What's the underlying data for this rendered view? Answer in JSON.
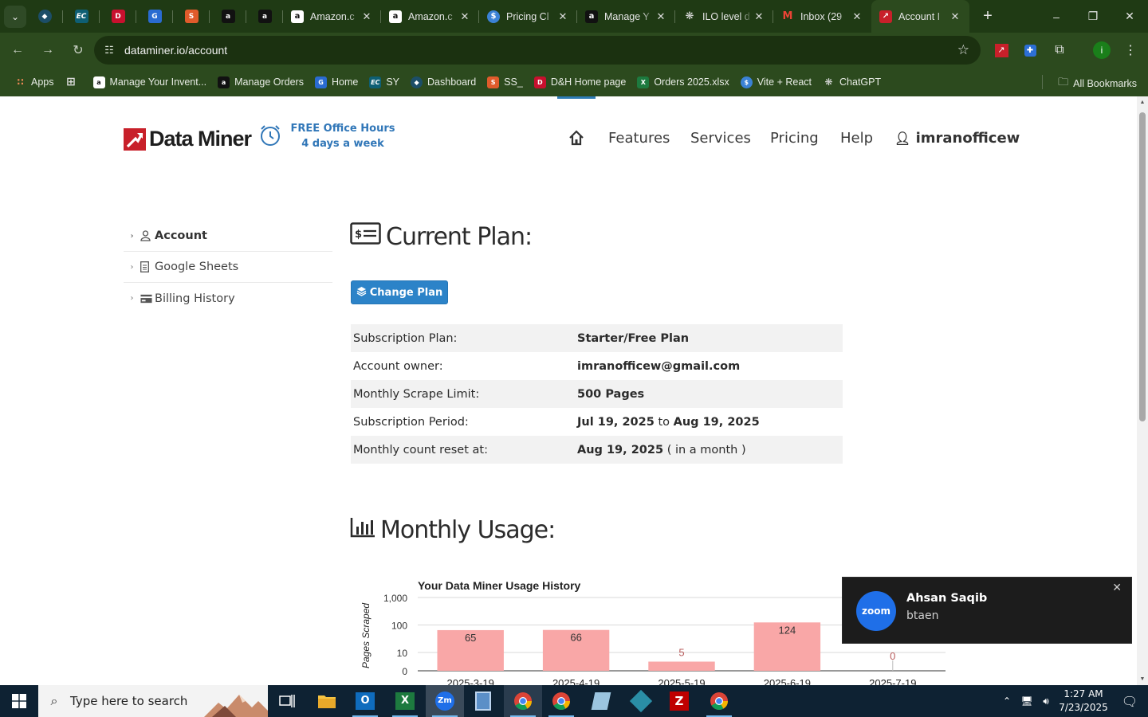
{
  "browser": {
    "tabs": [
      {
        "title": "Amazon.c",
        "icon": "amazon"
      },
      {
        "title": "Amazon.c",
        "icon": "amazon"
      },
      {
        "title": "Pricing Cl",
        "icon": "pricing"
      },
      {
        "title": "Manage Y",
        "icon": "amazon"
      },
      {
        "title": "ILO level d",
        "icon": "openai"
      },
      {
        "title": "Inbox (29",
        "icon": "gmail"
      },
      {
        "title": "Account I",
        "icon": "dataminer"
      }
    ],
    "url": "dataminer.io/account",
    "bookmarks": [
      {
        "label": "Apps"
      },
      {
        "label": "Manage Your Invent..."
      },
      {
        "label": "Manage Orders"
      },
      {
        "label": "Home"
      },
      {
        "label": "SY"
      },
      {
        "label": "Dashboard"
      },
      {
        "label": "SS_"
      },
      {
        "label": "D&H Home page"
      },
      {
        "label": "Orders 2025.xlsx"
      },
      {
        "label": "Vite + React"
      },
      {
        "label": "ChatGPT"
      }
    ],
    "all_bookmarks": "All Bookmarks",
    "profile_initial": "i"
  },
  "site": {
    "logo": "Data Miner",
    "office_line1": "FREE Office Hours",
    "office_line2": "4 days a week",
    "nav": {
      "features": "Features",
      "services": "Services",
      "pricing": "Pricing",
      "help": "Help",
      "user": "imranofficew"
    }
  },
  "sidebar": {
    "items": [
      {
        "label": "Account"
      },
      {
        "label": "Google Sheets"
      },
      {
        "label": "Billing History"
      }
    ]
  },
  "current_plan": {
    "heading": "Current Plan:",
    "change_button": "Change Plan",
    "rows": [
      {
        "key": "Subscription Plan:",
        "value": "Starter/Free Plan"
      },
      {
        "key": "Account owner:",
        "value": "imranofficew@gmail.com"
      },
      {
        "key": "Monthly Scrape Limit:",
        "value": "500 Pages"
      },
      {
        "key": "Subscription Period:",
        "from": "Jul 19, 2025",
        "sep": "to",
        "to": "Aug 19, 2025"
      },
      {
        "key": "Monthly count reset at:",
        "value": "Aug 19, 2025",
        "note": "( in a month )"
      }
    ]
  },
  "monthly_usage": {
    "heading": "Monthly Usage:"
  },
  "chart_data": {
    "type": "bar",
    "title": "Your Data Miner Usage History",
    "ylabel": "Pages Scraped",
    "xlabel": "",
    "yscale": "log",
    "yticks": [
      "1,000",
      "100",
      "10",
      "0"
    ],
    "categories": [
      "2025-3-19",
      "2025-4-19",
      "2025-5-19",
      "2025-6-19",
      "2025-7-19"
    ],
    "values": [
      65,
      66,
      5,
      124,
      0
    ],
    "labels": [
      "65",
      "66",
      "5",
      "124",
      "0"
    ],
    "bar_color": "#f9a7a7",
    "label_color_small": "#b85c5c"
  },
  "toast": {
    "app": "zoom",
    "name": "Ahsan Saqib",
    "message": "btaen"
  },
  "taskbar": {
    "search_placeholder": "Type here to search",
    "time": "1:27 AM",
    "date": "7/23/2025"
  }
}
